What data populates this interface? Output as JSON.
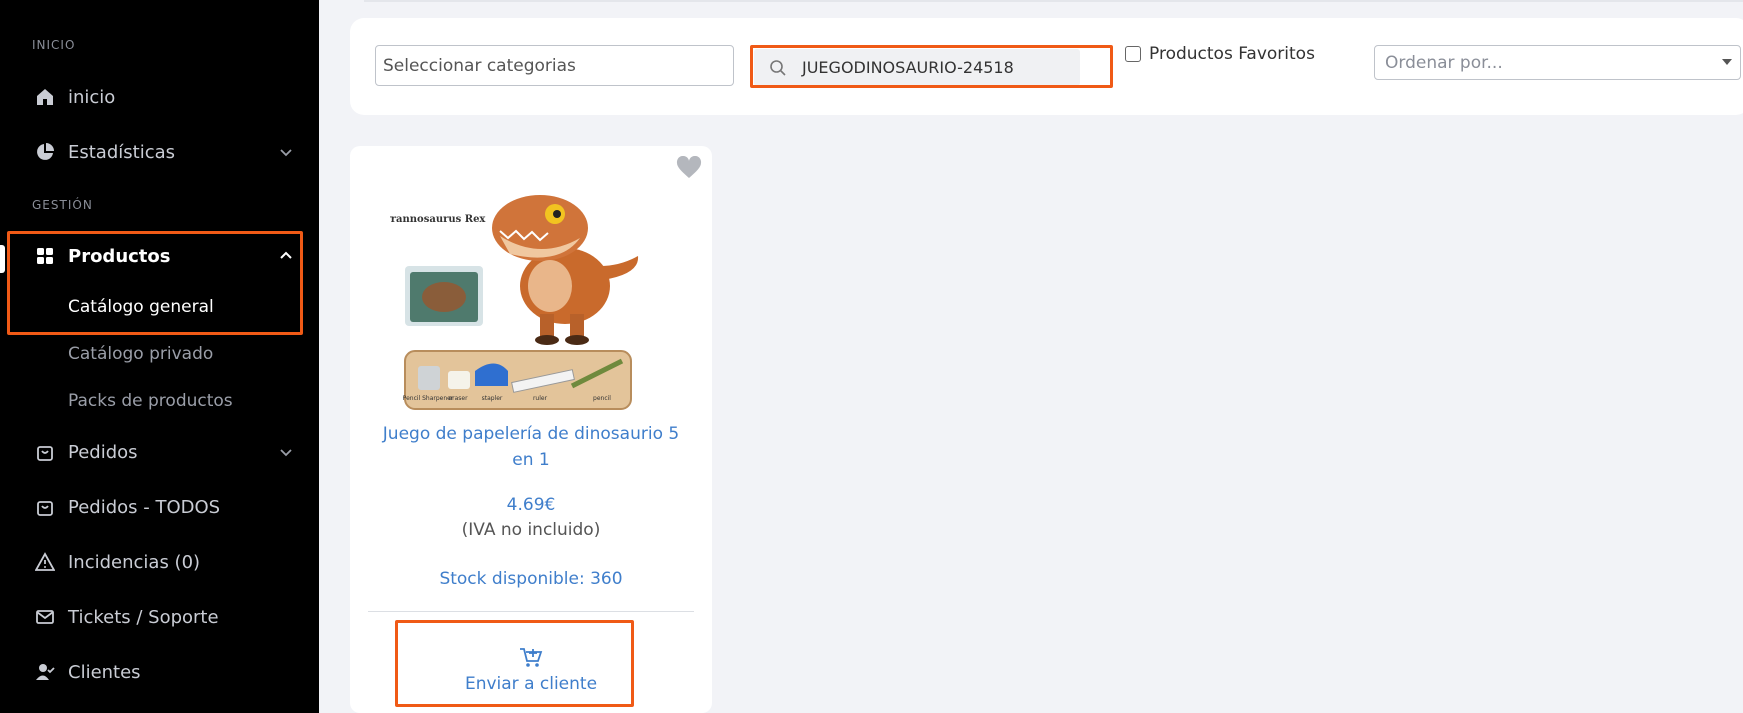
{
  "sidebar": {
    "section_inicio": "INICIO",
    "section_gestion": "GESTIÓN",
    "items": [
      {
        "label": "inicio",
        "icon": "home-icon"
      },
      {
        "label": "Estadísticas",
        "icon": "pie-chart-icon"
      },
      {
        "label": "Productos",
        "icon": "grid-icon"
      },
      {
        "label": "Pedidos",
        "icon": "shopping-bag-icon"
      },
      {
        "label": "Pedidos - TODOS",
        "icon": "shopping-bag-icon"
      },
      {
        "label": "Incidencias (0)",
        "icon": "warning-icon"
      },
      {
        "label": "Tickets / Soporte",
        "icon": "mail-icon"
      },
      {
        "label": "Clientes",
        "icon": "user-check-icon"
      }
    ],
    "sub_items": [
      "Catálogo general",
      "Catálogo privado",
      "Packs de productos"
    ]
  },
  "filters": {
    "category_placeholder": "Seleccionar categorias",
    "search_value": "JUEGODINOSAURIO-24518",
    "favorites_label": "Productos Favoritos",
    "order_placeholder": "Ordenar por..."
  },
  "product": {
    "image_text_title": "Tyrannosaurus Rex",
    "image_tool_labels": [
      "Pencil Sharpener",
      "eraser",
      "stapler",
      "ruler",
      "pencil"
    ],
    "title": "Juego de papelería de dinosaurio 5 en 1",
    "price": "4.69€",
    "iva": "(IVA no incluido)",
    "stock": "Stock disponible: 360",
    "send_label": "Enviar a cliente"
  },
  "colors": {
    "sidebar_bg": "#000000",
    "accent_blue": "#3f7ecb",
    "highlight_orange": "#f05a16",
    "page_bg": "#f2f3f7"
  }
}
